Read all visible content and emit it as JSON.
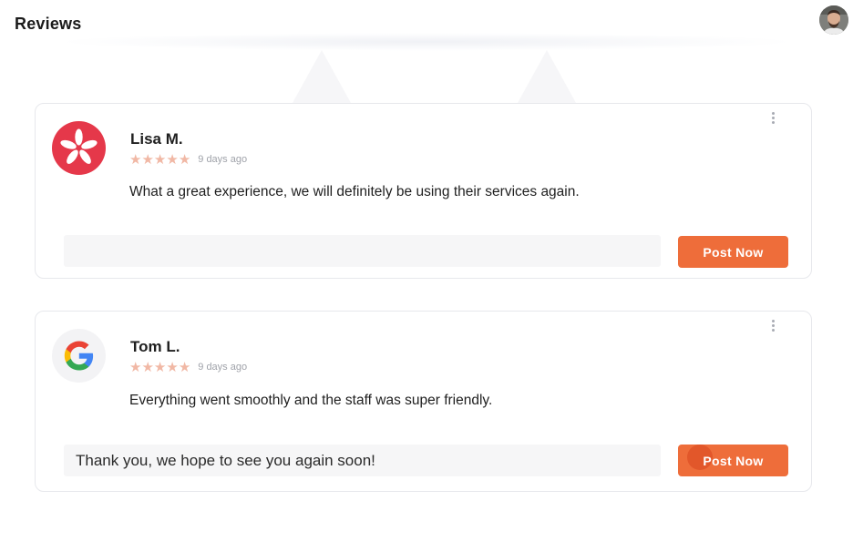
{
  "header": {
    "title": "Reviews"
  },
  "colors": {
    "accent": "#ee6d3a",
    "star": "#f1b8a5",
    "yelp_red": "#e5384a",
    "card_border": "#e7e8ec",
    "field_bg": "#f6f6f7"
  },
  "reviews": [
    {
      "source_icon": "yelp-icon",
      "name": "Lisa M.",
      "rating": 5,
      "age": "9 days ago",
      "text": "What a great experience, we will definitely be using their services again.",
      "reply_value": "",
      "button_label": "Post Now"
    },
    {
      "source_icon": "google-icon",
      "name": "Tom L.",
      "rating": 5,
      "age": "9 days ago",
      "text": "Everything went smoothly and the staff was super friendly.",
      "reply_value": "Thank you, we hope to see you again soon!",
      "button_label": "Post Now"
    }
  ],
  "stars": {
    "glyph": "★"
  }
}
